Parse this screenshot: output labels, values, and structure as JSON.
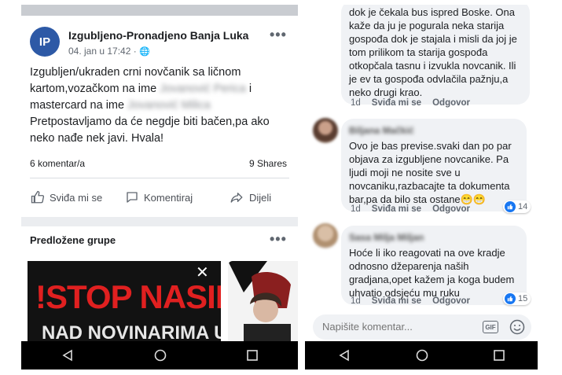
{
  "left": {
    "post": {
      "avatar_initials": "IP",
      "page_name": "Izgubljeno-Pronadjeno Banja Luka",
      "meta": "04. jan u 17:42 · ",
      "more": "•••",
      "text_1": "Izgubljen/ukraden crni novčanik sa ličnom kartom,vozačkom na ime",
      "redacted_1": "Jovanović Perica",
      "text_2": "i mastercard na ime",
      "redacted_2": "Jovanović Milica",
      "text_3": "Pretpostavljamo da će negdje biti bačen,pa ako neko nađe nek javi. Hvala!",
      "comments_count": "6 komentar/a",
      "shares_count": "9 Shares",
      "actions": {
        "like": "Sviđa mi se",
        "comment": "Komentiraj",
        "share": "Dijeli"
      }
    },
    "suggested": {
      "title": "Predložene grupe",
      "more": "•••",
      "card_headline": "!STOP NASILJ",
      "card_subline": "NAD NOVINARIMA U",
      "close": "✕"
    }
  },
  "right": {
    "comments": [
      {
        "text": "dok je čekala bus ispred Boske. Ona kaže da ju je pogurala neka starija gospođa dok je stajala i misli da joj je tom prilikom ta starija gospođa otkopčala tasnu i izvukla novcanik. Ili je ev ta gospođa odvlačila pažnju,a neko drugi krao.",
        "time": "1d",
        "like": "Sviđa mi se",
        "reply": "Odgovor"
      },
      {
        "author": "Biljana Mačkić",
        "text": "Ovo je bas previse.svaki dan po par objava za izgubljene novcanike. Pa ljudi moji ne nosite sve u novcaniku,razbacajte ta dokumenta bar,pa da bilo sta ostane😁😁",
        "time": "1d",
        "like": "Sviđa mi se",
        "reply": "Odgovor",
        "reactions": "14"
      },
      {
        "author": "Sasa Milja Miljan",
        "text": "Hoće li iko reagovati na ove kradje odnosno džeparenja naših gradjana,opet kažem ja koga budem uhvatio odsjeću mu ruku",
        "time": "1d",
        "like": "Sviđa mi se",
        "reply": "Odgovor",
        "reactions": "15"
      }
    ],
    "composer": {
      "placeholder": "Napišite komentar...",
      "gif": "GIF"
    }
  },
  "colors": {
    "accent": "#1877f2",
    "brand_avatar": "#2d59a6",
    "stop_red": "#e02020"
  }
}
